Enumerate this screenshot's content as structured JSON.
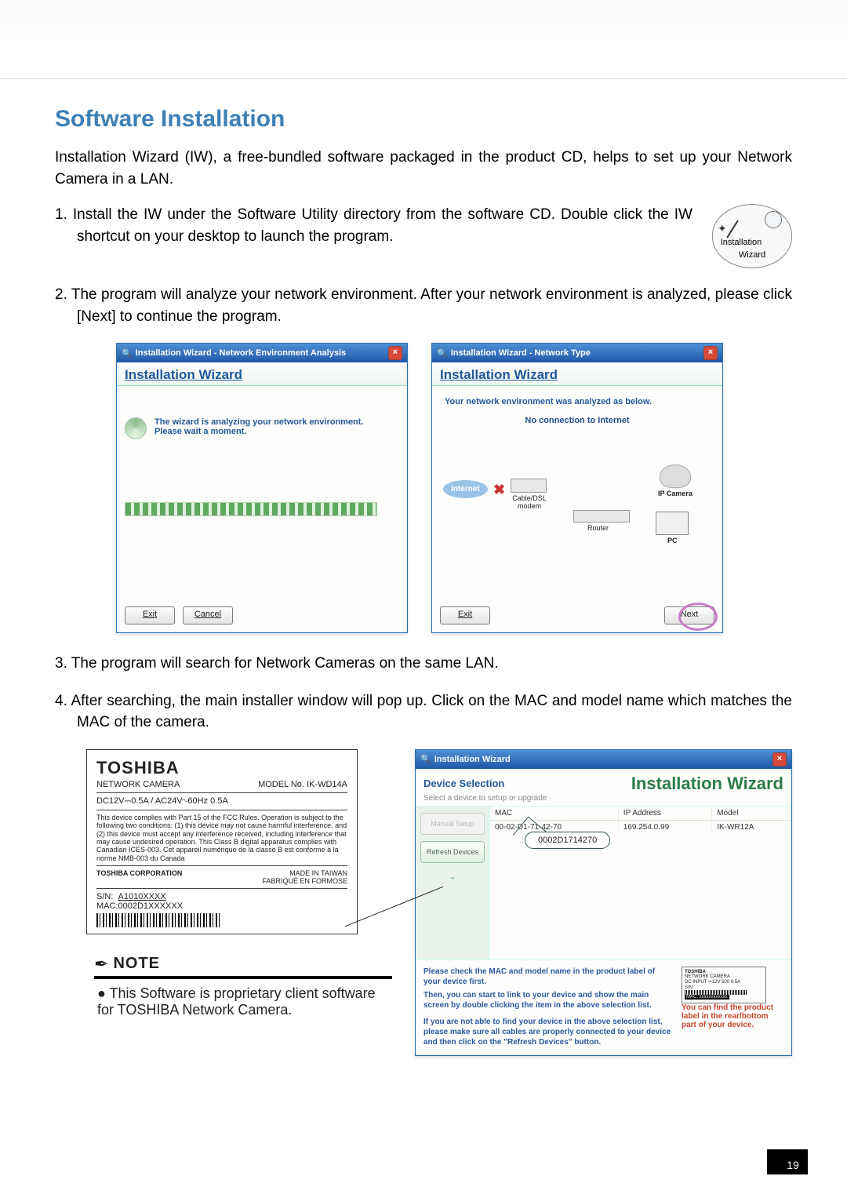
{
  "page": {
    "number": "19"
  },
  "section_title": "Software Installation",
  "intro": "Installation Wizard (IW), a free-bundled software packaged in the product CD, helps to set up your Network Camera in a LAN.",
  "steps": {
    "1": "1. Install the IW under the Software Utility directory from the software CD. Double click the IW shortcut on your desktop to launch the program.",
    "2": "2. The program will analyze your network environment. After your network environment is analyzed, please click [Next] to continue the program.",
    "3": "3. The program will search for Network Cameras on the same LAN.",
    "4": "4. After searching, the main installer window will pop up. Click on the MAC and model name which matches the MAC of the camera."
  },
  "wizard_icon": {
    "label": "Installation\nWizard"
  },
  "dialog_a": {
    "title": "Installation Wizard - Network Environment Analysis",
    "header": "Installation Wizard",
    "msg_line1": "The wizard is analyzing your network environment.",
    "msg_line2": "Please wait a moment.",
    "btn_exit": "Exit",
    "btn_cancel": "Cancel"
  },
  "dialog_b": {
    "title": "Installation Wizard - Network Type",
    "header": "Installation Wizard",
    "analyzed": "Your network environment was analyzed as below.",
    "no_internet": "No connection to Internet",
    "lbl_internet": "Internet",
    "lbl_modem": "Cable/DSL modem",
    "lbl_router": "Router",
    "lbl_camera": "IP Camera",
    "lbl_pc": "PC",
    "btn_exit": "Exit",
    "btn_next": "Next"
  },
  "label_plate": {
    "brand": "TOSHIBA",
    "product": "NETWORK CAMERA",
    "model_label": "MODEL No.",
    "model": "IK-WD14A",
    "power": "DC12V⎓0.5A / AC24V∿60Hz 0.5A",
    "fcc": "This device complies with Part 15 of the FCC Rules. Operation is subject to the following two conditions: (1) this device may not cause harmful interference, and (2) this device must accept any interference received, including interference that may cause undesired operation. This Class B digital apparatus complies with Canadian ICES-003. Cet appareil numérique de la classe B est conforme à la norme NMB-003 du Canada",
    "corp": "TOSHIBA CORPORATION",
    "made": "MADE IN TAIWAN",
    "fab": "FABRIQUÉ EN FORMOSE",
    "sn_label": "S/N:",
    "sn": "A1010XXXX",
    "mac_label": "MAC:",
    "mac": "0002D1XXXXXX"
  },
  "big_wizard": {
    "title": "Installation Wizard",
    "device_selection": "Device Selection",
    "iw_header": "Installation Wizard",
    "desc": "Select a device to setup or upgrade",
    "side": {
      "manual": "Manual Setup",
      "refresh": "Refresh Devices"
    },
    "columns": {
      "mac": "MAC",
      "ip": "IP Address",
      "model": "Model"
    },
    "row": {
      "mac": "00-02-D1-71-42-70",
      "ip": "169.254.0.99",
      "model": "IK-WR12A"
    },
    "callout": "0002D1714270",
    "hint1": "Please check the MAC and model name in the product label of your device first.",
    "hint2": "Then, you can start to link to your device and show the main screen by double clicking the item in the above selection list.",
    "hint3": "If you are not able to find your device in the above selection list, please make sure all cables are properly connected to your device and then click on the \"Refresh Devices\" button.",
    "mini_hint": "You can find the product label in the rear/bottom part of your device.",
    "mini_plate": {
      "brand": "TOSHIBA",
      "line1": "NETWORK CAMERA",
      "line2": "DC INPUT ⎓12V 500 0.5A",
      "sn": "S/N:",
      "mac": "MAC: xxxxxxxxxxxx"
    }
  },
  "note": {
    "heading": "NOTE",
    "bullet": "● This Software is proprietary client software for TOSHIBA Network Camera."
  }
}
